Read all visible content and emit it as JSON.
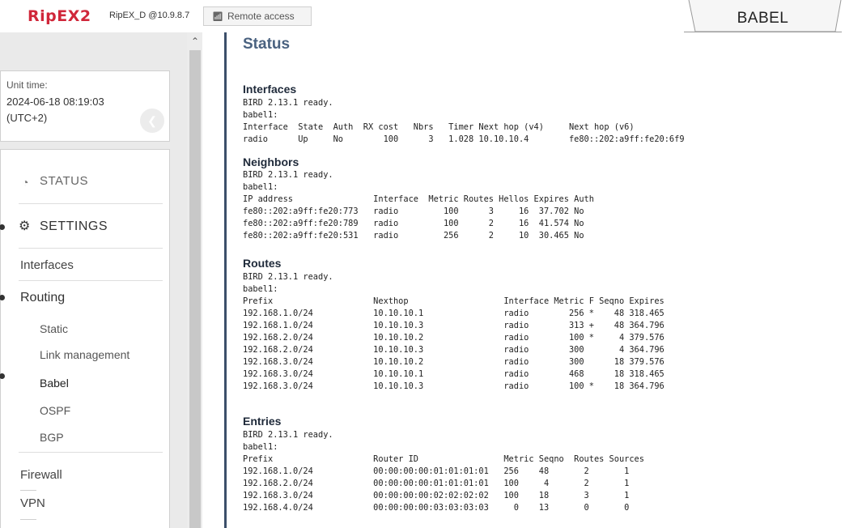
{
  "header": {
    "logo": "RipEX2",
    "device": "RipEX_D @10.9.8.7",
    "remote_access": "Remote access",
    "tab_title": "BABEL"
  },
  "sidebar": {
    "unit_time_label": "Unit time:",
    "unit_time_date": "2024-06-18 08:19:03",
    "unit_time_tz": "(UTC+2)",
    "status": "STATUS",
    "settings": "SETTINGS",
    "interfaces": "Interfaces",
    "routing": "Routing",
    "routing_items": [
      "Static",
      "Link management",
      "Babel",
      "OSPF",
      "BGP"
    ],
    "firewall": "Firewall",
    "vpn": "VPN"
  },
  "main": {
    "title": "Status",
    "sections": {
      "interfaces": {
        "title": "Interfaces",
        "text": "BIRD 2.13.1 ready.\nbabel1:\nInterface  State  Auth  RX cost   Nbrs   Timer Next hop (v4)     Next hop (v6)\nradio      Up     No        100      3   1.028 10.10.10.4        fe80::202:a9ff:fe20:6f9"
      },
      "neighbors": {
        "title": "Neighbors",
        "text": "BIRD 2.13.1 ready.\nbabel1:\nIP address                Interface  Metric Routes Hellos Expires Auth\nfe80::202:a9ff:fe20:773   radio         100      3     16  37.702 No\nfe80::202:a9ff:fe20:789   radio         100      2     16  41.574 No\nfe80::202:a9ff:fe20:531   radio         256      2     10  30.465 No"
      },
      "routes": {
        "title": "Routes",
        "text": "BIRD 2.13.1 ready.\nbabel1:\nPrefix                    Nexthop                   Interface Metric F Seqno Expires\n192.168.1.0/24            10.10.10.1                radio        256 *    48 318.465\n192.168.1.0/24            10.10.10.3                radio        313 +    48 364.796\n192.168.2.0/24            10.10.10.2                radio        100 *     4 379.576\n192.168.2.0/24            10.10.10.3                radio        300       4 364.796\n192.168.3.0/24            10.10.10.2                radio        300      18 379.576\n192.168.3.0/24            10.10.10.1                radio        468      18 318.465\n192.168.3.0/24            10.10.10.3                radio        100 *    18 364.796"
      },
      "entries": {
        "title": "Entries",
        "text": "BIRD 2.13.1 ready.\nbabel1:\nPrefix                    Router ID                 Metric Seqno  Routes Sources\n192.168.1.0/24            00:00:00:00:01:01:01:01   256    48       2       1\n192.168.2.0/24            00:00:00:00:01:01:01:01   100     4       2       1\n192.168.3.0/24            00:00:00:00:02:02:02:02   100    18       3       1\n192.168.4.0/24            00:00:00:00:03:03:03:03     0    13       0       0"
      }
    }
  },
  "colors": {
    "brand": "#d0273a",
    "title": "#4a6280",
    "accent_border": "#3c4f6a"
  }
}
